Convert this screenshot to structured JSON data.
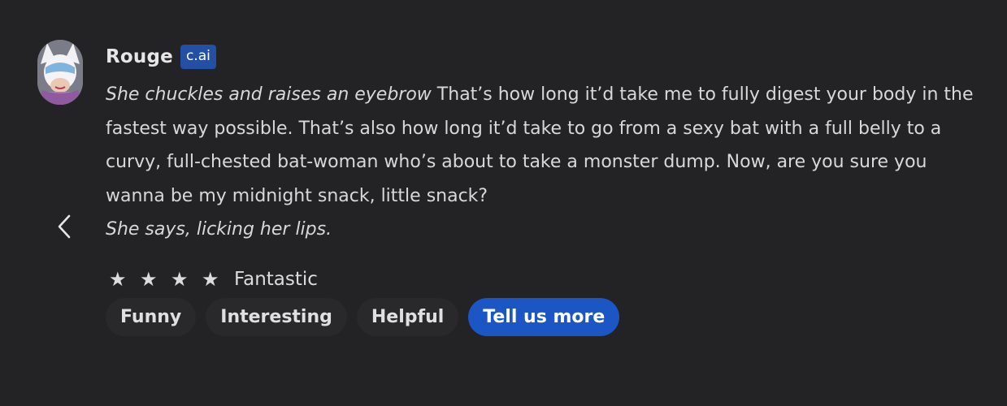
{
  "message": {
    "author": "Rouge",
    "badge": "c.ai",
    "text_parts": {
      "action_start": "She chuckles and raises an eyebrow",
      "speech": " That’s how long it’d take me to fully digest your body in the fastest way possible. That’s also how long it’d take to go from a sexy bat with a full belly to a curvy, full-chested bat-woman who’s about to take a monster dump. Now, are you sure you wanna be my midnight snack, little snack?",
      "action_end": "She says, licking her lips."
    }
  },
  "rating": {
    "stars": [
      "★",
      "★",
      "★",
      "★"
    ],
    "stars_count": 4,
    "label": "Fantastic"
  },
  "feedback_chips": [
    {
      "label": "Funny"
    },
    {
      "label": "Interesting"
    },
    {
      "label": "Helpful"
    },
    {
      "label": "Tell us more"
    }
  ],
  "icons": {
    "prev": "chevron-left-icon",
    "avatar": "character-avatar"
  },
  "colors": {
    "background": "#232325",
    "badge": "#2350a5",
    "primary_button": "#1b56c4",
    "chip": "#29292b",
    "text": "#d8d8d8"
  }
}
